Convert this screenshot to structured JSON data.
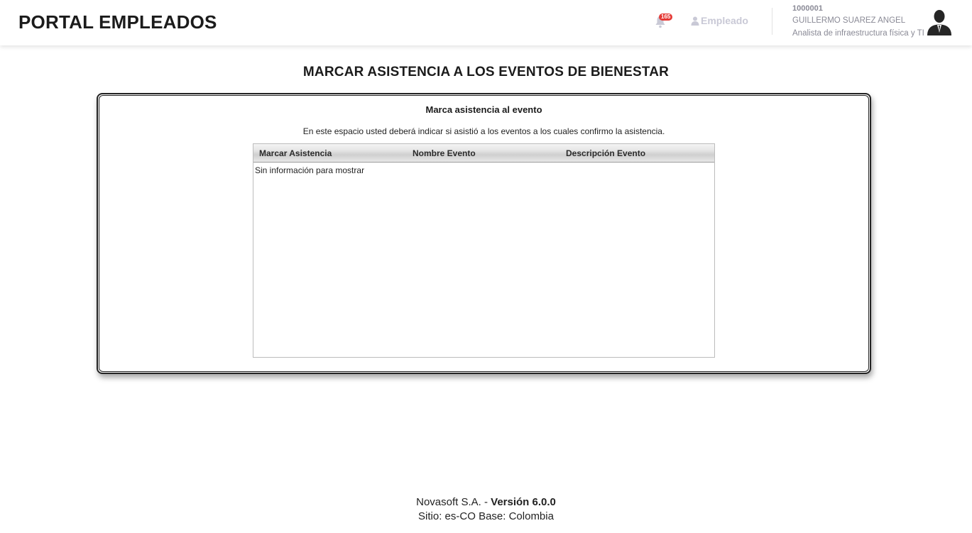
{
  "header": {
    "brand": "PORTAL EMPLEADOS",
    "notifications": {
      "icon": "bell-icon",
      "count": "165"
    },
    "role": {
      "icon": "user-icon",
      "label": "Empleado"
    },
    "user": {
      "id": "1000001",
      "name": "GUILLERMO SUAREZ ANGEL",
      "position": "Analista de infraestructura física y TI",
      "avatar_icon": "avatar-icon"
    }
  },
  "main": {
    "title": "MARCAR ASISTENCIA A LOS EVENTOS DE BIENESTAR",
    "panel": {
      "heading": "Marca asistencia al evento",
      "description": "En este espacio usted deberá indicar si asistió a los eventos a los cuales confirmo la asistencia.",
      "table": {
        "columns": [
          "Marcar Asistencia",
          "Nombre Evento",
          "Descripción Evento"
        ],
        "rows": [],
        "empty_message": "Sin información para mostrar"
      }
    }
  },
  "footer": {
    "company": "Novasoft S.A. - ",
    "version": "Versión 6.0.0",
    "site": "Sitio: es-CO Base: Colombia"
  },
  "colors": {
    "badge": "#e53935",
    "muted_text": "#8a8a96",
    "role_text": "#c9c9d6"
  }
}
